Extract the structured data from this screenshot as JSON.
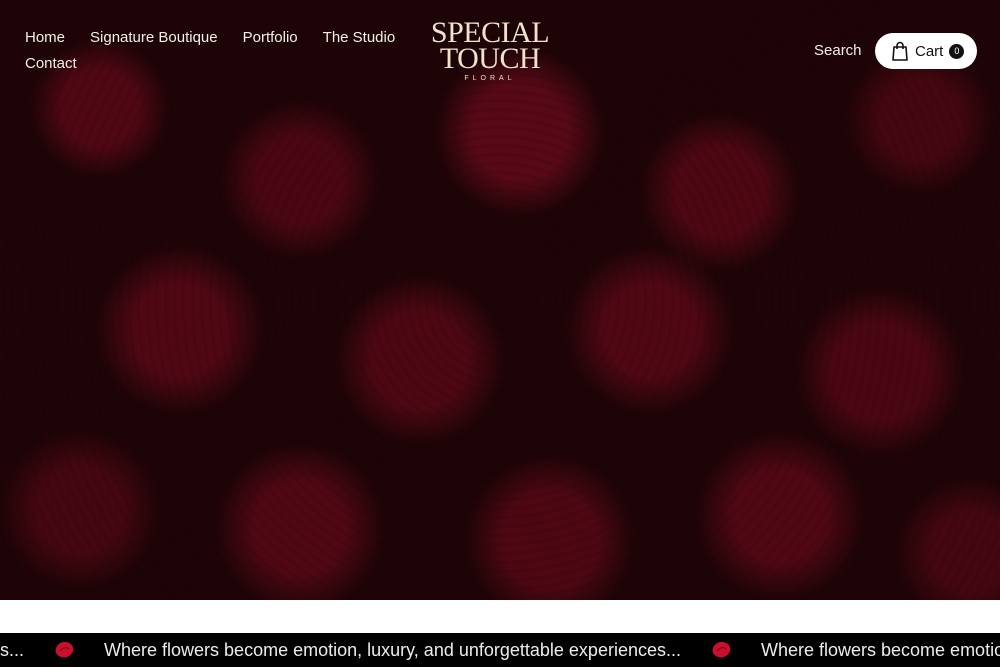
{
  "nav": {
    "items": [
      "Home",
      "Signature Boutique",
      "Portfolio",
      "The Studio",
      "Contact"
    ]
  },
  "logo": {
    "line1": "SPECIAL",
    "line2": "TOUCH",
    "sub": "FLORAL"
  },
  "header": {
    "search_label": "Search",
    "cart_label": "Cart",
    "cart_count": "0"
  },
  "marquee": {
    "text": "Where flowers become emotion, luxury, and unforgettable experiences...",
    "lead_fragment": "ces...",
    "icon": "rose-petal-icon"
  },
  "colors": {
    "hero_base": "#1e0407",
    "rose": "#7a0a1e",
    "logo": "#efe3c9",
    "marquee_bg": "#000000",
    "petal": "#c8102e"
  }
}
